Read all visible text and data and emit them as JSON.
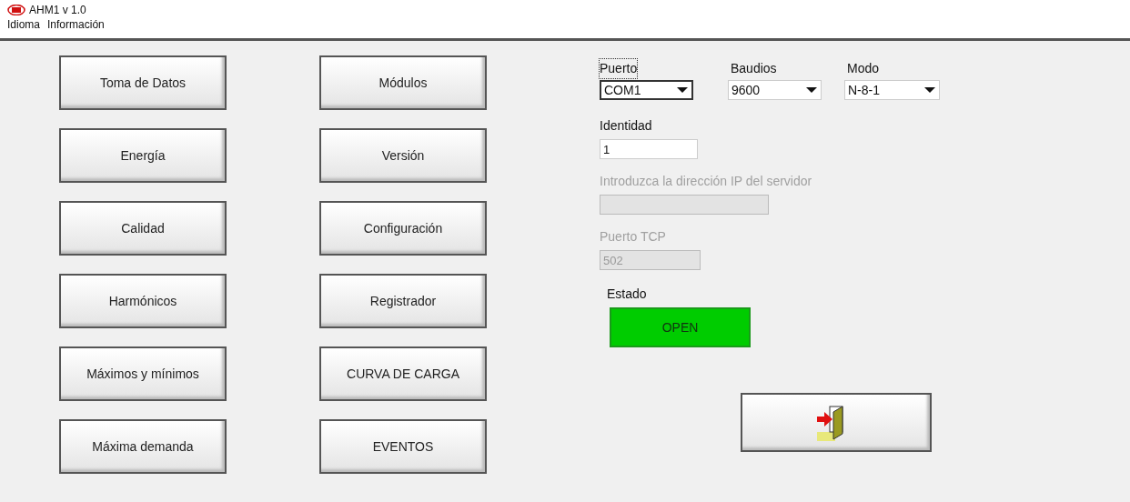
{
  "window": {
    "title": "AHM1 v 1.0"
  },
  "menu": [
    "Idioma",
    "Información"
  ],
  "button_columns": [
    [
      "Toma de Datos",
      "Energía",
      "Calidad",
      "Harmónicos",
      "Máximos y mínimos",
      "Máxima demanda"
    ],
    [
      "Módulos",
      "Versión",
      "Configuración",
      "Registrador",
      "CURVA DE CARGA",
      "EVENTOS"
    ]
  ],
  "serial": [
    {
      "label": "Puerto",
      "value": "COM1",
      "focused": true
    },
    {
      "label": "Baudios",
      "value": "9600",
      "focused": false
    },
    {
      "label": "Modo",
      "value": "N-8-1",
      "focused": false
    }
  ],
  "identity": {
    "label": "Identidad",
    "value": "1",
    "disabled": false
  },
  "server_ip": {
    "label": "Introduzca la dirección IP del servidor",
    "disabled": true
  },
  "tcp_port": {
    "label": "Puerto TCP",
    "value": "502",
    "disabled": true
  },
  "status": {
    "label": "Estado",
    "value": "OPEN"
  }
}
